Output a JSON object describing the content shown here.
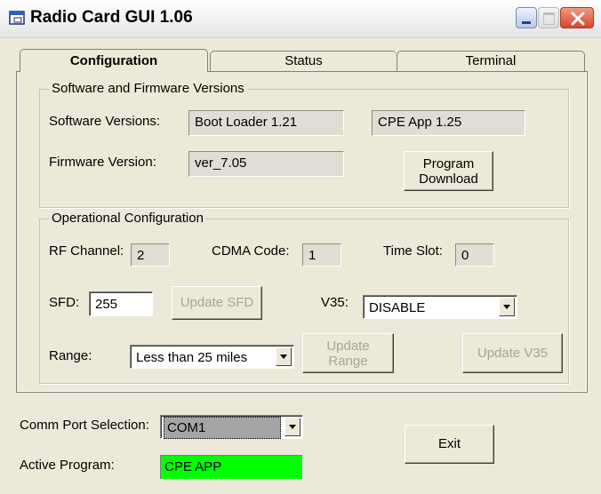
{
  "window": {
    "title": "Radio Card GUI 1.06"
  },
  "tabs": [
    {
      "label": "Configuration",
      "active": true
    },
    {
      "label": "Status",
      "active": false
    },
    {
      "label": "Terminal",
      "active": false
    }
  ],
  "software_group": {
    "title": "Software and Firmware Versions",
    "software_label": "Software Versions:",
    "boot_loader": "Boot Loader 1.21",
    "cpe_app": "CPE App 1.25",
    "firmware_label": "Firmware Version:",
    "firmware_value": "ver_7.05",
    "program_download": "Program\nDownload"
  },
  "operational_group": {
    "title": "Operational Configuration",
    "rf_channel_label": "RF Channel:",
    "rf_channel_value": "2",
    "cdma_label": "CDMA Code:",
    "cdma_value": "1",
    "timeslot_label": "Time Slot:",
    "timeslot_value": "0",
    "sfd_label": "SFD:",
    "sfd_value": "255",
    "update_sfd": "Update SFD",
    "v35_label": "V35:",
    "v35_value": "DISABLE",
    "range_label": "Range:",
    "range_value": "Less than 25 miles",
    "update_range": "Update\nRange",
    "update_v35": "Update V35"
  },
  "bottom": {
    "comm_port_label": "Comm Port Selection:",
    "comm_port_value": "COM1",
    "active_program_label": "Active Program:",
    "active_program_value": "CPE APP",
    "exit_label": "Exit"
  },
  "colors": {
    "active_program_bg": "#00ff00",
    "window_bg": "#ece9d8"
  }
}
